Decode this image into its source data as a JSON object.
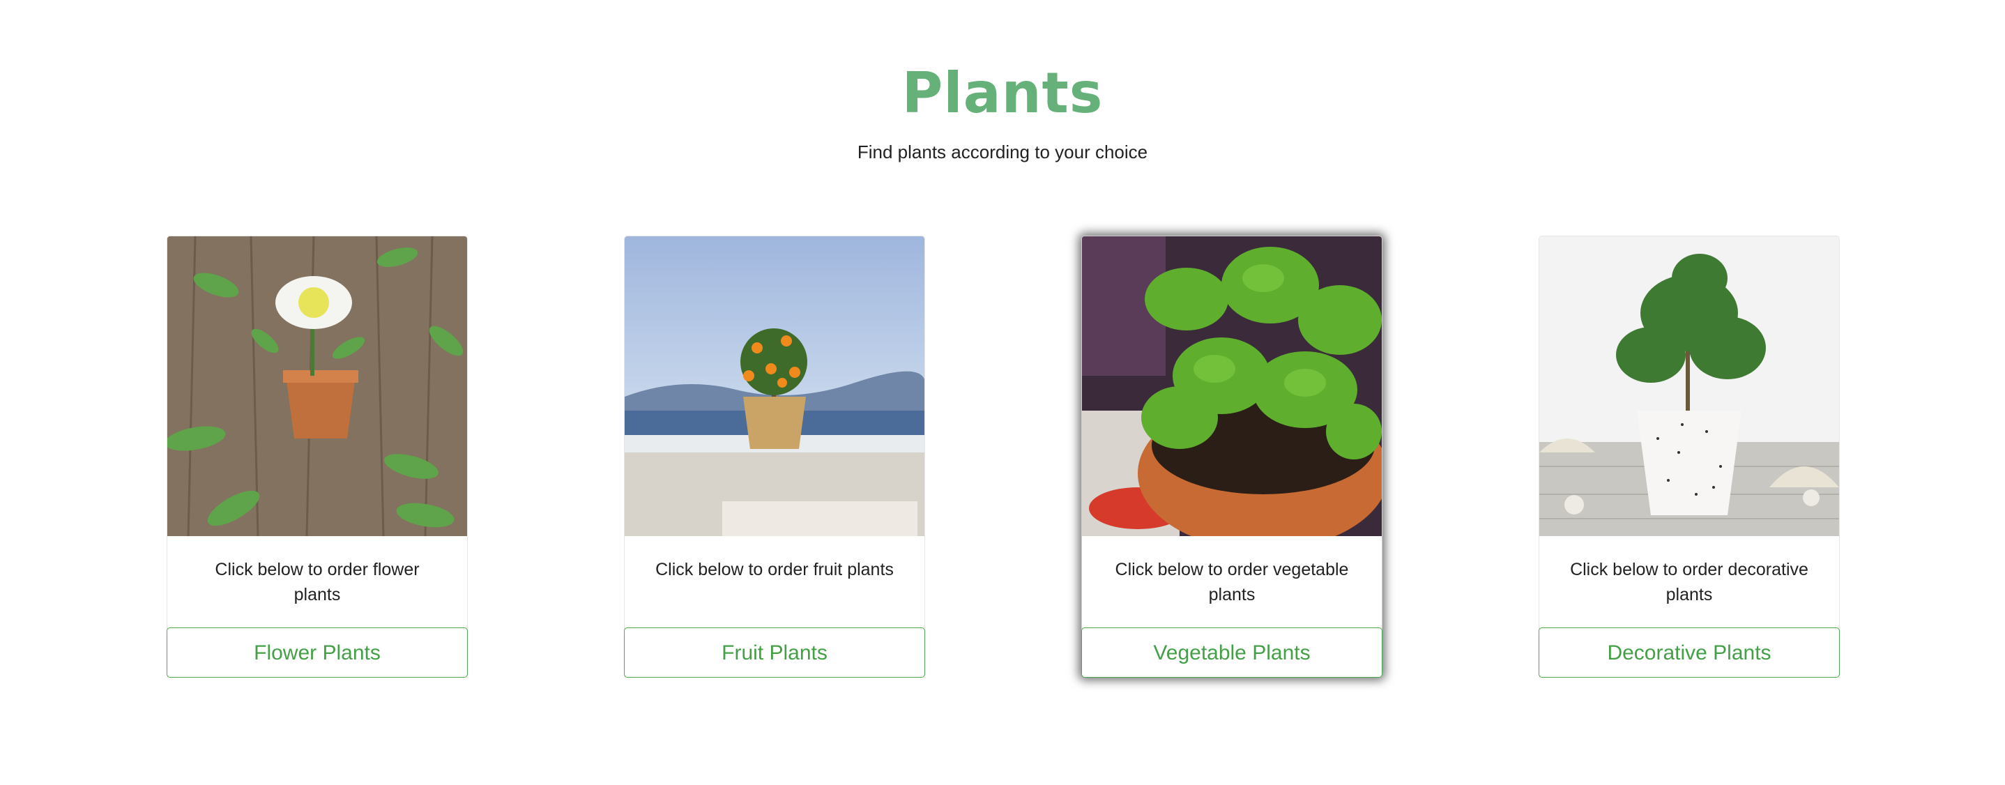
{
  "header": {
    "title": "Plants",
    "subtitle": "Find plants according to your choice"
  },
  "cards": [
    {
      "image": "flower-plant-photo",
      "text": "Click below to order flower plants",
      "button_label": "Flower Plants"
    },
    {
      "image": "fruit-plant-photo",
      "text": "Click below to order fruit plants",
      "button_label": "Fruit Plants"
    },
    {
      "image": "vegetable-plant-photo",
      "text": "Click below to order vegetable plants",
      "button_label": "Vegetable Plants"
    },
    {
      "image": "decorative-plant-photo",
      "text": "Click below to order decorative plants",
      "button_label": "Decorative Plants"
    }
  ],
  "colors": {
    "title": "#66b07a",
    "button_border": "#4aa84f",
    "button_text": "#43a047"
  }
}
